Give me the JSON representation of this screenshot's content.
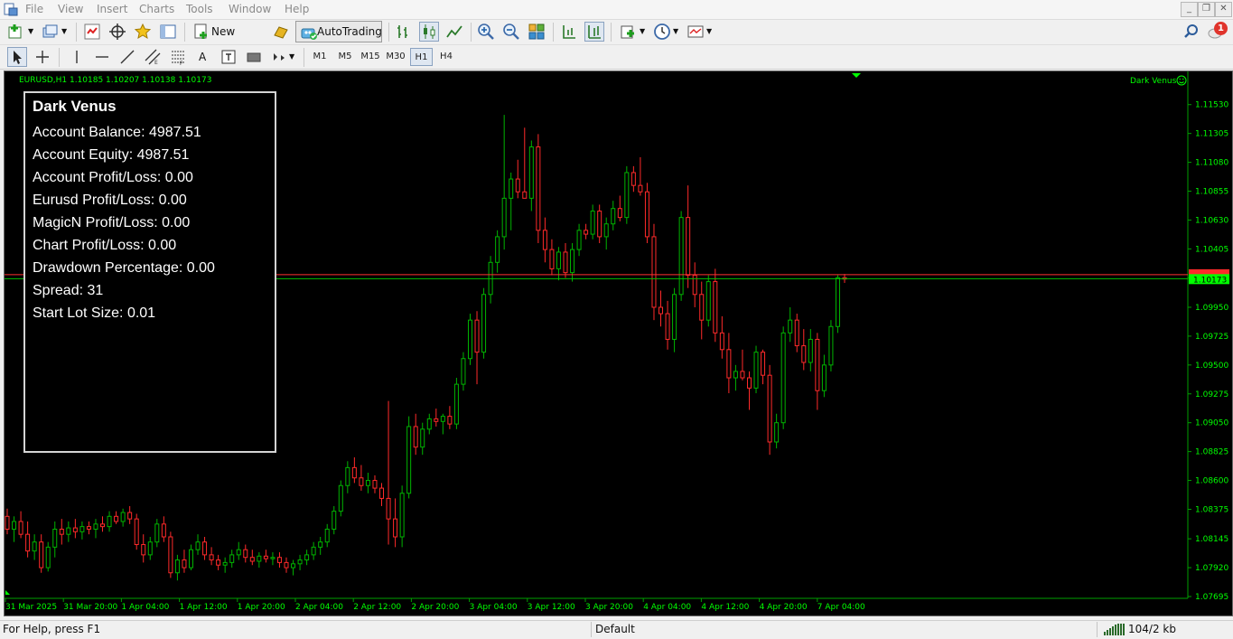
{
  "menu": {
    "items": [
      "File",
      "View",
      "Insert",
      "Charts",
      "Tools",
      "Window",
      "Help"
    ]
  },
  "toolbar": {
    "new_order_label": "New Order",
    "autotrading_label": "AutoTrading",
    "timeframes": [
      "M1",
      "M5",
      "M15",
      "M30",
      "H1",
      "H4"
    ],
    "active_timeframe": "H1",
    "notification_count": "1"
  },
  "chart": {
    "header": "EURUSD,H1  1.10185 1.10207 1.10138 1.10173",
    "ea_label": "Dark Venus",
    "current_price": "1.10173",
    "red_line_price": "1.10204",
    "colors": {
      "bull": "#00b400",
      "bear": "#ff2a2a",
      "grid": "#00a000",
      "axis_text": "#00ff00",
      "background": "#000000"
    }
  },
  "panel": {
    "title": "Dark Venus",
    "lines": [
      "Account Balance: 4987.51",
      "Account Equity: 4987.51",
      "Account Profit/Loss: 0.00",
      "Eurusd Profit/Loss: 0.00",
      "MagicN Profit/Loss: 0.00",
      "Chart Profit/Loss: 0.00",
      "Drawdown Percentage: 0.00",
      "Spread: 31",
      "Start Lot Size: 0.01"
    ]
  },
  "status": {
    "help": "For Help, press F1",
    "profile": "Default",
    "traffic": "104/2 kb"
  },
  "chart_data": {
    "type": "candlestick",
    "symbol": "EURUSD",
    "timeframe": "H1",
    "ylim": [
      1.07695,
      1.11655
    ],
    "y_ticks": [
      "1.11530",
      "1.11305",
      "1.11080",
      "1.10855",
      "1.10630",
      "1.10405",
      "1.10180",
      "1.09950",
      "1.09725",
      "1.09500",
      "1.09275",
      "1.09050",
      "1.08825",
      "1.08600",
      "1.08375",
      "1.08145",
      "1.07920",
      "1.07695"
    ],
    "x_ticks": [
      "31 Mar 2025",
      "31 Mar 20:00",
      "1 Apr 04:00",
      "1 Apr 12:00",
      "1 Apr 20:00",
      "2 Apr 04:00",
      "2 Apr 12:00",
      "2 Apr 20:00",
      "3 Apr 04:00",
      "3 Apr 12:00",
      "3 Apr 20:00",
      "4 Apr 04:00",
      "4 Apr 12:00",
      "4 Apr 20:00",
      "7 Apr 04:00"
    ],
    "candles": [
      [
        1.0832,
        1.0838,
        1.0818,
        1.0822
      ],
      [
        1.0822,
        1.0832,
        1.0812,
        1.0828
      ],
      [
        1.0828,
        1.0836,
        1.0815,
        1.0818
      ],
      [
        1.0818,
        1.0828,
        1.08,
        1.0805
      ],
      [
        1.0805,
        1.0818,
        1.0798,
        1.0812
      ],
      [
        1.0812,
        1.0818,
        1.0788,
        1.0792
      ],
      [
        1.0792,
        1.0812,
        1.0789,
        1.0808
      ],
      [
        1.0808,
        1.0828,
        1.08,
        1.0822
      ],
      [
        1.0822,
        1.083,
        1.081,
        1.0818
      ],
      [
        1.0818,
        1.0828,
        1.0812,
        1.0823
      ],
      [
        1.0823,
        1.083,
        1.0815,
        1.082
      ],
      [
        1.082,
        1.0828,
        1.0814,
        1.0824
      ],
      [
        1.0824,
        1.0828,
        1.0818,
        1.0822
      ],
      [
        1.0822,
        1.083,
        1.0815,
        1.0826
      ],
      [
        1.0826,
        1.0832,
        1.082,
        1.0824
      ],
      [
        1.0824,
        1.0836,
        1.082,
        1.0832
      ],
      [
        1.0832,
        1.0836,
        1.0826,
        1.0828
      ],
      [
        1.0828,
        1.0838,
        1.0824,
        1.0835
      ],
      [
        1.0835,
        1.084,
        1.0826,
        1.083
      ],
      [
        1.083,
        1.0834,
        1.0806,
        1.081
      ],
      [
        1.081,
        1.0818,
        1.0796,
        1.0802
      ],
      [
        1.0802,
        1.0816,
        1.0798,
        1.0812
      ],
      [
        1.0812,
        1.083,
        1.0808,
        1.0826
      ],
      [
        1.0826,
        1.0832,
        1.0812,
        1.0816
      ],
      [
        1.0816,
        1.082,
        1.0784,
        1.0788
      ],
      [
        1.0788,
        1.0802,
        1.0782,
        1.0798
      ],
      [
        1.0798,
        1.0806,
        1.0788,
        1.0792
      ],
      [
        1.0792,
        1.081,
        1.079,
        1.0806
      ],
      [
        1.0806,
        1.0818,
        1.0802,
        1.0812
      ],
      [
        1.0812,
        1.0816,
        1.0798,
        1.0802
      ],
      [
        1.0802,
        1.0808,
        1.0794,
        1.0798
      ],
      [
        1.0798,
        1.0802,
        1.079,
        1.0794
      ],
      [
        1.0794,
        1.08,
        1.0788,
        1.0796
      ],
      [
        1.0796,
        1.0806,
        1.0792,
        1.0802
      ],
      [
        1.0802,
        1.0812,
        1.0798,
        1.0806
      ],
      [
        1.0806,
        1.081,
        1.0796,
        1.08
      ],
      [
        1.08,
        1.0806,
        1.0794,
        1.0797
      ],
      [
        1.0797,
        1.0804,
        1.0792,
        1.0801
      ],
      [
        1.0801,
        1.0806,
        1.0796,
        1.0799
      ],
      [
        1.0799,
        1.0804,
        1.0794,
        1.08
      ],
      [
        1.08,
        1.0804,
        1.0792,
        1.0796
      ],
      [
        1.0796,
        1.08,
        1.0788,
        1.0792
      ],
      [
        1.0792,
        1.0798,
        1.0786,
        1.0795
      ],
      [
        1.0795,
        1.0802,
        1.079,
        1.0798
      ],
      [
        1.0798,
        1.0806,
        1.0794,
        1.0802
      ],
      [
        1.0802,
        1.0812,
        1.0798,
        1.0808
      ],
      [
        1.0808,
        1.0816,
        1.0802,
        1.0812
      ],
      [
        1.0812,
        1.0826,
        1.0808,
        1.0822
      ],
      [
        1.0822,
        1.084,
        1.0818,
        1.0836
      ],
      [
        1.0836,
        1.086,
        1.0832,
        1.0856
      ],
      [
        1.0856,
        1.0875,
        1.085,
        1.087
      ],
      [
        1.087,
        1.0878,
        1.0858,
        1.0862
      ],
      [
        1.0862,
        1.0872,
        1.0852,
        1.0856
      ],
      [
        1.0856,
        1.0866,
        1.085,
        1.086
      ],
      [
        1.086,
        1.0864,
        1.085,
        1.0854
      ],
      [
        1.0854,
        1.0858,
        1.084,
        1.0846
      ],
      [
        1.0846,
        1.0922,
        1.081,
        1.083
      ],
      [
        1.083,
        1.0846,
        1.0808,
        1.0816
      ],
      [
        1.0816,
        1.0856,
        1.0808,
        1.085
      ],
      [
        1.085,
        1.091,
        1.0846,
        1.0902
      ],
      [
        1.0902,
        1.0912,
        1.088,
        1.0886
      ],
      [
        1.0886,
        1.0905,
        1.088,
        1.09
      ],
      [
        1.09,
        1.0912,
        1.0896,
        1.0908
      ],
      [
        1.0908,
        1.0916,
        1.0902,
        1.0906
      ],
      [
        1.0906,
        1.0912,
        1.0896,
        1.091
      ],
      [
        1.091,
        1.0918,
        1.09,
        1.0904
      ],
      [
        1.0904,
        1.094,
        1.09,
        1.0935
      ],
      [
        1.0935,
        1.096,
        1.093,
        1.0955
      ],
      [
        1.0955,
        1.099,
        1.095,
        1.0985
      ],
      [
        1.0985,
        1.0992,
        1.0935,
        1.096
      ],
      [
        1.096,
        1.101,
        1.0955,
        1.1005
      ],
      [
        1.1005,
        1.1035,
        1.0998,
        1.103
      ],
      [
        1.103,
        1.1055,
        1.1022,
        1.105
      ],
      [
        1.105,
        1.1145,
        1.104,
        1.108
      ],
      [
        1.108,
        1.11,
        1.1055,
        1.1095
      ],
      [
        1.1095,
        1.111,
        1.108,
        1.1085
      ],
      [
        1.1085,
        1.1135,
        1.108,
        1.108
      ],
      [
        1.108,
        1.1125,
        1.107,
        1.112
      ],
      [
        1.112,
        1.113,
        1.1045,
        1.1055
      ],
      [
        1.1055,
        1.1065,
        1.103,
        1.104
      ],
      [
        1.104,
        1.1048,
        1.102,
        1.1025
      ],
      [
        1.1025,
        1.1042,
        1.1016,
        1.1038
      ],
      [
        1.1038,
        1.1045,
        1.1018,
        1.1022
      ],
      [
        1.1022,
        1.1045,
        1.1015,
        1.104
      ],
      [
        1.104,
        1.106,
        1.1035,
        1.1055
      ],
      [
        1.1055,
        1.106,
        1.1048,
        1.1052
      ],
      [
        1.1052,
        1.1075,
        1.1048,
        1.107
      ],
      [
        1.107,
        1.1075,
        1.1045,
        1.105
      ],
      [
        1.105,
        1.1065,
        1.104,
        1.106
      ],
      [
        1.106,
        1.1078,
        1.1055,
        1.1072
      ],
      [
        1.1072,
        1.1082,
        1.1062,
        1.1065
      ],
      [
        1.1065,
        1.1105,
        1.106,
        1.11
      ],
      [
        1.11,
        1.1105,
        1.1085,
        1.109
      ],
      [
        1.109,
        1.1112,
        1.1082,
        1.1085
      ],
      [
        1.1085,
        1.1092,
        1.1045,
        1.105
      ],
      [
        1.105,
        1.106,
        1.0985,
        1.0995
      ],
      [
        1.0995,
        1.1008,
        1.098,
        1.099
      ],
      [
        1.099,
        1.1,
        1.0962,
        1.097
      ],
      [
        1.097,
        1.101,
        1.096,
        1.1005
      ],
      [
        1.1005,
        1.107,
        1.1,
        1.1065
      ],
      [
        1.1065,
        1.109,
        1.101,
        1.102
      ],
      [
        1.102,
        1.103,
        1.0995,
        1.1005
      ],
      [
        1.1005,
        1.1015,
        1.097,
        1.0985
      ],
      [
        1.0985,
        1.102,
        1.098,
        1.1015
      ],
      [
        1.1015,
        1.1025,
        1.0968,
        1.0975
      ],
      [
        1.0975,
        1.0988,
        1.0955,
        1.0962
      ],
      [
        1.0962,
        1.0975,
        1.0928,
        1.094
      ],
      [
        1.094,
        1.095,
        1.093,
        1.0945
      ],
      [
        1.0945,
        1.0962,
        1.0938,
        1.094
      ],
      [
        1.094,
        1.0945,
        1.0915,
        1.0932
      ],
      [
        1.0932,
        1.0965,
        1.0928,
        1.096
      ],
      [
        1.096,
        1.0962,
        1.0935,
        1.0942
      ],
      [
        1.0942,
        1.095,
        1.088,
        1.089
      ],
      [
        1.089,
        1.0912,
        1.0885,
        1.0905
      ],
      [
        1.0905,
        1.098,
        1.09,
        1.0975
      ],
      [
        1.0975,
        1.0995,
        1.0968,
        1.0985
      ],
      [
        1.0985,
        1.099,
        1.096,
        1.0965
      ],
      [
        1.0965,
        1.0978,
        1.0946,
        1.0952
      ],
      [
        1.0952,
        1.0978,
        1.0945,
        1.097
      ],
      [
        1.097,
        1.0975,
        1.0915,
        1.093
      ],
      [
        1.093,
        1.0958,
        1.0925,
        1.095
      ],
      [
        1.095,
        1.0985,
        1.0945,
        1.098
      ],
      [
        1.098,
        1.102,
        1.0975,
        1.1018
      ],
      [
        1.1018,
        1.1021,
        1.1014,
        1.1017
      ]
    ]
  }
}
